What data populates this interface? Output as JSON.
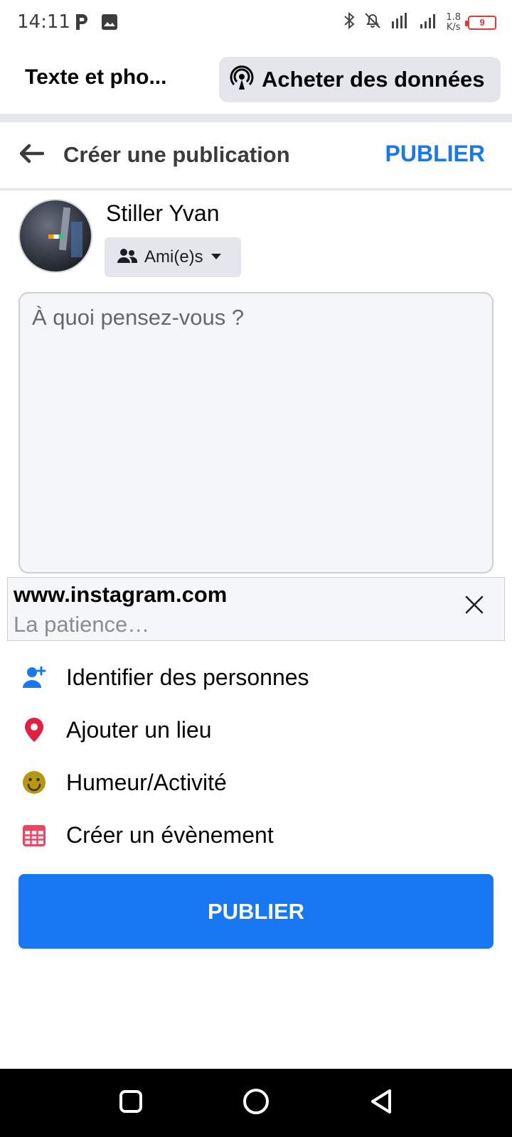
{
  "status_bar": {
    "time": "14:11",
    "speed_value": "1.8",
    "speed_unit": "K/s",
    "battery": "9"
  },
  "top_bar": {
    "title": "Texte et pho...",
    "buy_data_label": "Acheter des données"
  },
  "header": {
    "title": "Créer une publication",
    "publish_label": "PUBLIER"
  },
  "user": {
    "name": "Stiller Yvan",
    "audience": "Ami(e)s"
  },
  "composer": {
    "placeholder": "À quoi pensez-vous ?",
    "value": ""
  },
  "link_preview": {
    "url": "www.instagram.com",
    "description": "La patience…"
  },
  "options": [
    {
      "label": "Identifier des personnes",
      "icon": "tag-people-icon",
      "color": "#1877f2"
    },
    {
      "label": "Ajouter un lieu",
      "icon": "location-pin-icon",
      "color": "#e41e3f"
    },
    {
      "label": "Humeur/Activité",
      "icon": "smiley-icon",
      "color": "#b6970e"
    },
    {
      "label": "Créer un évènement",
      "icon": "calendar-icon",
      "color": "#f3425f"
    }
  ],
  "publish_button": {
    "label": "PUBLIER"
  },
  "colors": {
    "accent": "#1877f2",
    "nav_background": "#000000"
  }
}
